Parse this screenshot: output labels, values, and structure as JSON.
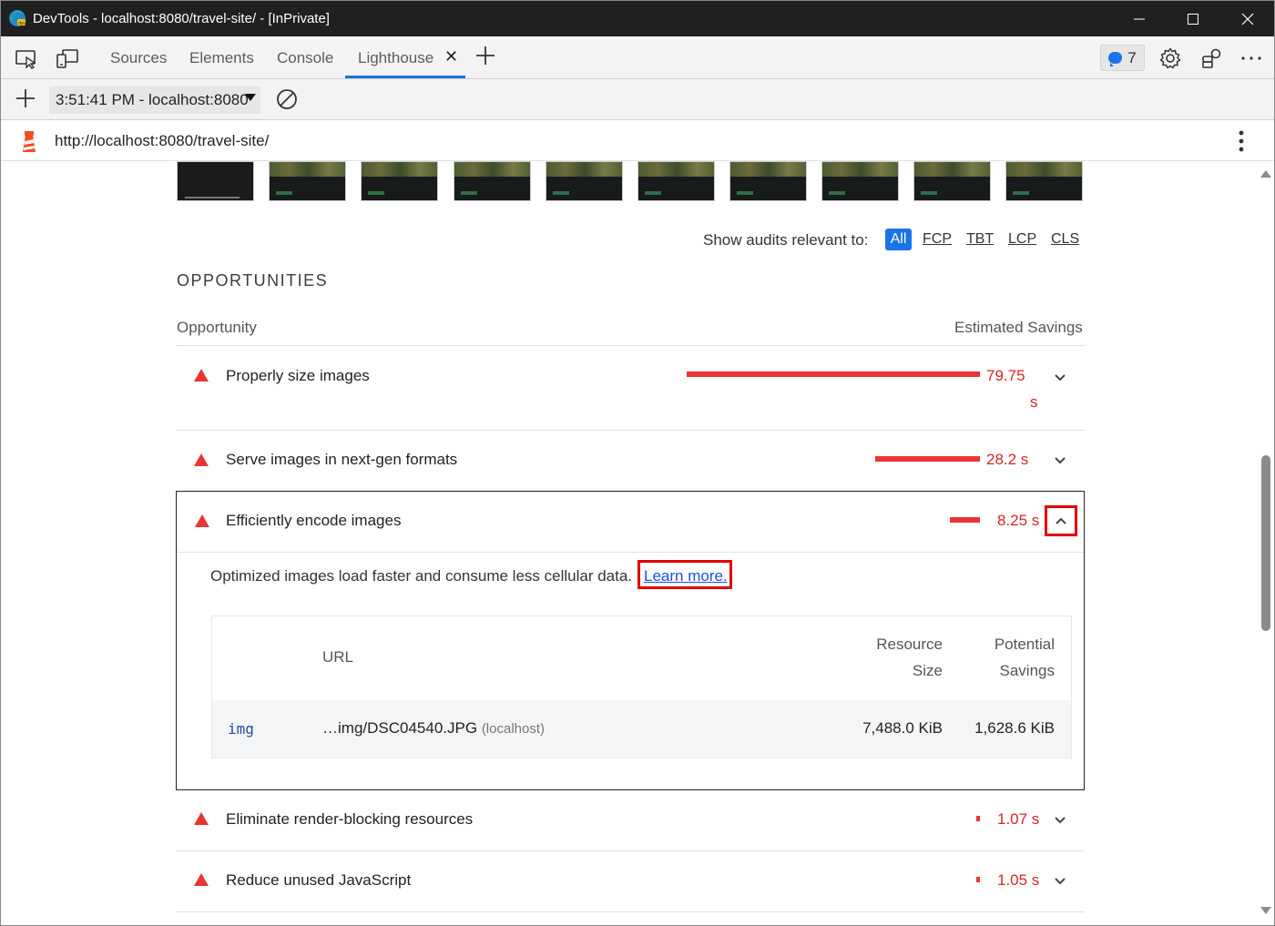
{
  "window": {
    "title": "DevTools - localhost:8080/travel-site/ - [InPrivate]"
  },
  "tabs": [
    {
      "label": "Sources"
    },
    {
      "label": "Elements"
    },
    {
      "label": "Console"
    },
    {
      "label": "Lighthouse",
      "active": true
    }
  ],
  "issues": {
    "count": "7"
  },
  "lighthouse_toolbar": {
    "report_select": "3:51:41 PM - localhost:8080"
  },
  "url": "http://localhost:8080/travel-site/",
  "filter": {
    "label": "Show audits relevant to:",
    "options": [
      "All",
      "FCP",
      "TBT",
      "LCP",
      "CLS"
    ],
    "selected": "All"
  },
  "opportunities": {
    "section_title": "OPPORTUNITIES",
    "col_opportunity": "Opportunity",
    "col_savings": "Estimated Savings",
    "items": [
      {
        "title": "Properly size images",
        "savings_line1": "79.75",
        "savings_line2": "s",
        "savings_seconds": 79.75
      },
      {
        "title": "Serve images in next-gen formats",
        "savings": "28.2 s",
        "savings_seconds": 28.2
      },
      {
        "title": "Efficiently encode images",
        "savings": "8.25 s",
        "savings_seconds": 8.25,
        "expanded": true
      },
      {
        "title": "Eliminate render-blocking resources",
        "savings": "1.07 s",
        "savings_seconds": 1.07
      },
      {
        "title": "Reduce unused JavaScript",
        "savings": "1.05 s",
        "savings_seconds": 1.05
      }
    ]
  },
  "expanded_audit": {
    "description": "Optimized images load faster and consume less cellular data.",
    "learn_more": "Learn more",
    "learn_more_suffix": ".",
    "table": {
      "col_url": "URL",
      "col_resource_line1": "Resource",
      "col_resource_line2": "Size",
      "col_savings_line1": "Potential",
      "col_savings_line2": "Savings",
      "rows": [
        {
          "element": "img",
          "url": "…img/DSC04540.JPG",
          "host": "(localhost)",
          "resource_size": "7,488.0 KiB",
          "potential_savings": "1,628.6 KiB"
        }
      ]
    }
  },
  "colors": {
    "fail": "#eb3434",
    "accent": "#1a73e8",
    "highlight_box": "#e00000"
  }
}
